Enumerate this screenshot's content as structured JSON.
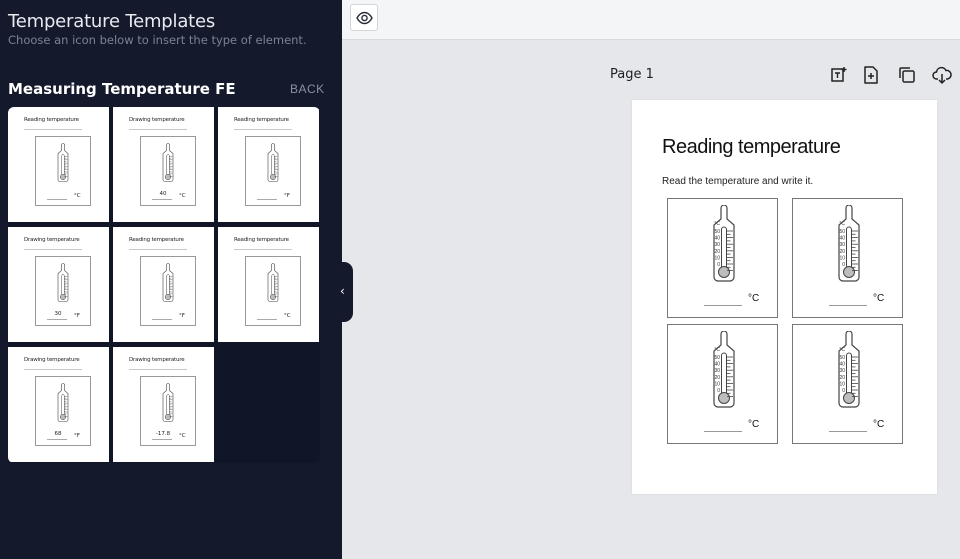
{
  "sidebar": {
    "title": "Temperature Templates",
    "subtitle": "Choose an icon below to insert the type of element.",
    "section_title": "Measuring Temperature FE",
    "back_label": "BACK",
    "templates": [
      {
        "title": "Reading temperature",
        "value": "",
        "unit": "°C"
      },
      {
        "title": "Drawing temperature",
        "value": "40",
        "unit": "°C"
      },
      {
        "title": "Reading temperature",
        "value": "",
        "unit": "°F"
      },
      {
        "title": "Drawing temperature",
        "value": "30",
        "unit": "°F"
      },
      {
        "title": "Reading temperature",
        "value": "",
        "unit": "°F"
      },
      {
        "title": "Reading temperature",
        "value": "",
        "unit": "°C"
      },
      {
        "title": "Drawing temperature",
        "value": "68",
        "unit": "°F"
      },
      {
        "title": "Drawing temperature",
        "value": "-17.8",
        "unit": "°C"
      }
    ]
  },
  "topbar": {
    "preview_icon": "eye-icon"
  },
  "page": {
    "label": "Page 1",
    "tools": [
      "add-text-icon",
      "add-page-icon",
      "duplicate-icon",
      "download-icon"
    ]
  },
  "worksheet": {
    "title": "Reading temperature",
    "instruction": "Read the temperature and write it.",
    "cells": [
      {
        "unit": "°C"
      },
      {
        "unit": "°C"
      },
      {
        "unit": "°C"
      },
      {
        "unit": "°C"
      }
    ],
    "scale_labels": [
      "°C",
      "50",
      "40",
      "30",
      "20",
      "10",
      "0"
    ]
  },
  "colors": {
    "sidebar_bg": "#141a2c",
    "canvas_bg": "#e6e7ea",
    "topbar_bg": "#f4f5f7"
  }
}
